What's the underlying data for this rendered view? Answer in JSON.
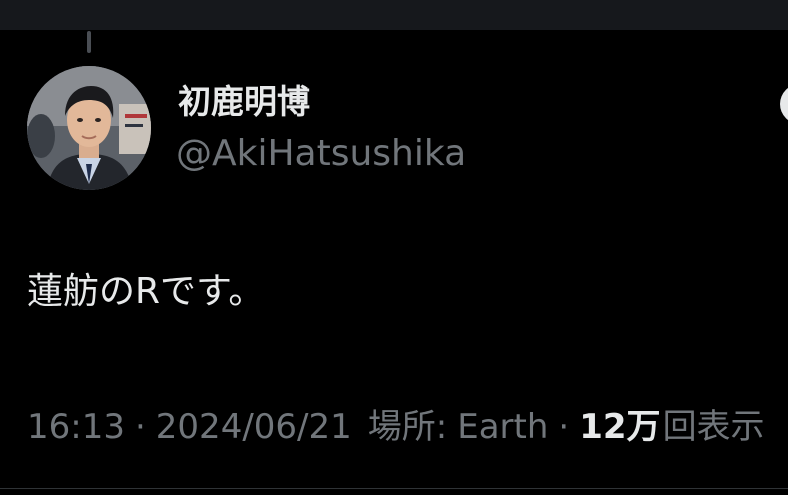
{
  "author": {
    "display_name": "初鹿明博",
    "handle": "@AkiHatsushika"
  },
  "tweet": {
    "text": "蓮舫のRです。"
  },
  "meta": {
    "time": "16:13",
    "separator": "·",
    "date": "2024/06/21",
    "location_label": "場所:",
    "location": "Earth",
    "views_count": "12万",
    "views_label": "回表示"
  },
  "colors": {
    "background": "#000000",
    "primary_text": "#e7e9ea",
    "secondary_text": "#71767b"
  },
  "icons": {
    "avatar": "profile-photo",
    "more": "more-menu-icon"
  }
}
